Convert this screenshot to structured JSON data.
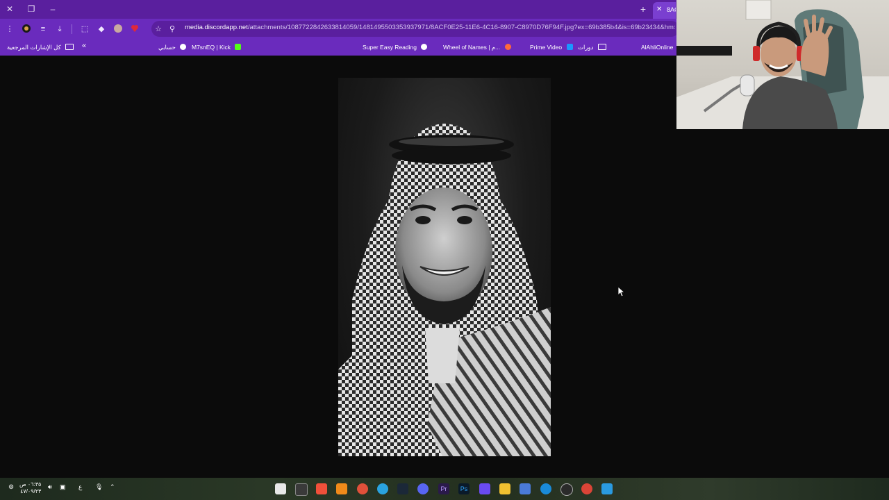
{
  "browser": {
    "active_tab_title": "8AC",
    "url_host": "media.discordapp.net",
    "url_path": "/attachments/1087722842633814059/1481495503353937971/8ACF0E25-11E6-4C16-8907-C8970D76F94F.jpg?ex=69b385b4&is=69b23434&hm=07b2"
  },
  "bookmarks": {
    "all_bookmarks": "كل الإشارات المرجعية",
    "items": [
      {
        "label": "حسابي"
      },
      {
        "label": "M7snEQ | Kick"
      },
      {
        "label": "Super Easy Reading"
      },
      {
        "label": "Wheel of Names | م..."
      },
      {
        "label": "Prime Video"
      },
      {
        "label": "دورات"
      },
      {
        "label": "AlAhliOnline"
      }
    ]
  },
  "taskbar": {
    "time": "٠٦:٣٥ ص",
    "date": "٤٧/٠٩/٢٣",
    "lang": "ع"
  },
  "colors": {
    "browser_purple": "#6a2bbd",
    "tab_strip": "#5a1f9e"
  }
}
